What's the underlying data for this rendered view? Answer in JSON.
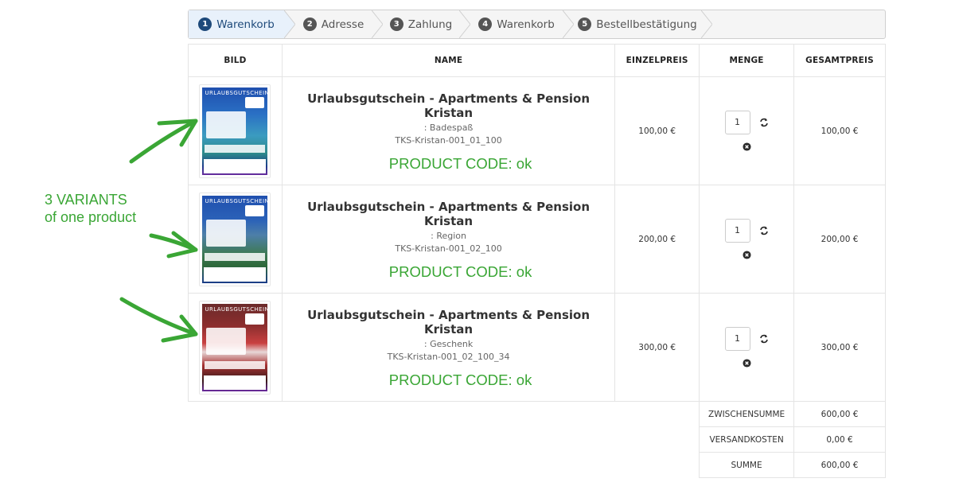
{
  "steps": [
    {
      "num": "1",
      "label": "Warenkorb"
    },
    {
      "num": "2",
      "label": "Adresse"
    },
    {
      "num": "3",
      "label": "Zahlung"
    },
    {
      "num": "4",
      "label": "Warenkorb"
    },
    {
      "num": "5",
      "label": "Bestellbestätigung"
    }
  ],
  "table": {
    "headers": {
      "image": "BILD",
      "name": "NAME",
      "unit_price": "EINZELPREIS",
      "quantity": "MENGE",
      "total": "GESAMTPREIS"
    },
    "rows": [
      {
        "voucher_title": "URLAUBSGUTSCHEIN",
        "name": "Urlaubsgutschein - Apartments & Pension Kristan",
        "variant": ": Badespaß",
        "sku": "TKS-Kristan-001_01_100",
        "note": "PRODUCT CODE: ok",
        "unit_price": "100,00 €",
        "qty": "1",
        "total": "100,00 €"
      },
      {
        "voucher_title": "URLAUBSGUTSCHEIN",
        "name": "Urlaubsgutschein - Apartments & Pension Kristan",
        "variant": ": Region",
        "sku": "TKS-Kristan-001_02_100",
        "note": "PRODUCT CODE: ok",
        "unit_price": "200,00 €",
        "qty": "1",
        "total": "200,00 €"
      },
      {
        "voucher_title": "URLAUBSGUTSCHEIN",
        "name": "Urlaubsgutschein - Apartments & Pension Kristan",
        "variant": ": Geschenk",
        "sku": "TKS-Kristan-001_02_100_34",
        "note": "PRODUCT CODE: ok",
        "unit_price": "300,00 €",
        "qty": "1",
        "total": "300,00 €"
      }
    ]
  },
  "summary": {
    "subtotal_label": "ZWISCHENSUMME",
    "subtotal": "600,00 €",
    "shipping_label": "VERSANDKOSTEN",
    "shipping": "0,00 €",
    "total_label": "SUMME",
    "total": "600,00 €"
  },
  "annotation": {
    "line1": "3 VARIANTS",
    "line2": "of one product"
  },
  "icons": {
    "refresh": "refresh-icon",
    "remove": "remove-circle-icon",
    "arrow": "hand-drawn-arrow"
  },
  "colors": {
    "accent_green": "#3aa635",
    "active_step": "#1e4a7b",
    "active_step_bg": "#e8f1fb"
  }
}
